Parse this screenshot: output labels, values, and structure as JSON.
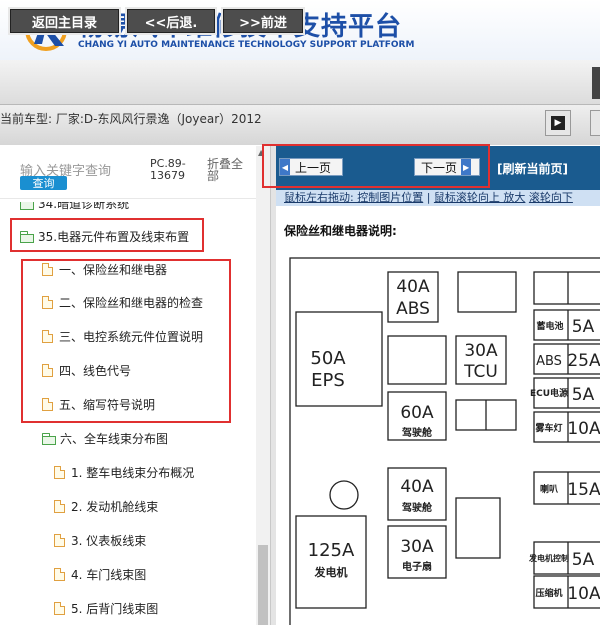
{
  "header": {
    "title_cn": "畅易汽车维修技术支持平台",
    "title_en": "CHANG YI AUTO MAINTENANCE TECHNOLOGY SUPPORT PLATFORM"
  },
  "nav": {
    "home": "返回主目录",
    "back": "<<后退.",
    "forward": ">>前进"
  },
  "car_info": "当前车型:  厂家:D-东风风行景逸（Joyear）2012",
  "sidebar": {
    "search_placeholder": "输入关键字查询",
    "search_button": "查询",
    "pc_label": "PC.89-13679",
    "collapse_label": "折叠全部",
    "partial_item": "34.暗道诊断系统",
    "section": "35.电器元件布置及线束布置",
    "items": [
      "一、保险丝和继电器",
      "二、保险丝和继电器的检查",
      "三、电控系统元件位置说明",
      "四、线色代号",
      "五、缩写符号说明"
    ],
    "subsection": "六、全车线束分布图",
    "subitems": [
      "1. 整车电线束分布概况",
      "2. 发动机舱线束",
      "3. 仪表板线束",
      "4. 车门线束图",
      "5. 后背门线束图"
    ]
  },
  "viewer": {
    "prev_page": "上一页",
    "next_page": "下一页",
    "refresh": "[刷新当前页]",
    "hint_drag": "鼠标左右拖动: 控制图片位置",
    "hint_sep": " | ",
    "hint_scroll": "鼠标滚轮向上 放大",
    "hint_scroll2": "滚轮向下",
    "diagram_title": "保险丝和继电器说明:"
  },
  "fuse_labels": {
    "f40_abs_a": "40A",
    "f40_abs_b": "ABS",
    "f50_eps_a": "50A",
    "f50_eps_b": "EPS",
    "f30_tcu_a": "30A",
    "f30_tcu_b": "TCU",
    "f60_a": "60A",
    "f60_b": "驾驶舱",
    "f40_b_a": "40A",
    "f40_b_b": "驾驶舱",
    "f125_a": "125A",
    "f125_b": "发电机",
    "f30_fan_a": "30A",
    "f30_fan_b": "电子扇",
    "r_batt": "蓄电池",
    "r_batt_v": "5A",
    "r_abs": "ABS",
    "r_abs_v": "25A",
    "r_ecu": "ECU电源",
    "r_ecu_v": "5A",
    "r_fog": "雾车灯",
    "r_fog_v": "10A",
    "r_horn": "喇叭",
    "r_horn_v": "15A",
    "r_gen": "发电机控制",
    "r_gen_v": "5A",
    "r_comp": "压缩机",
    "r_comp_v": "10A"
  },
  "colors": {
    "accent": "#1d4fa7",
    "viewer_bar": "#1a5b8f",
    "highlight": "#e03030"
  }
}
